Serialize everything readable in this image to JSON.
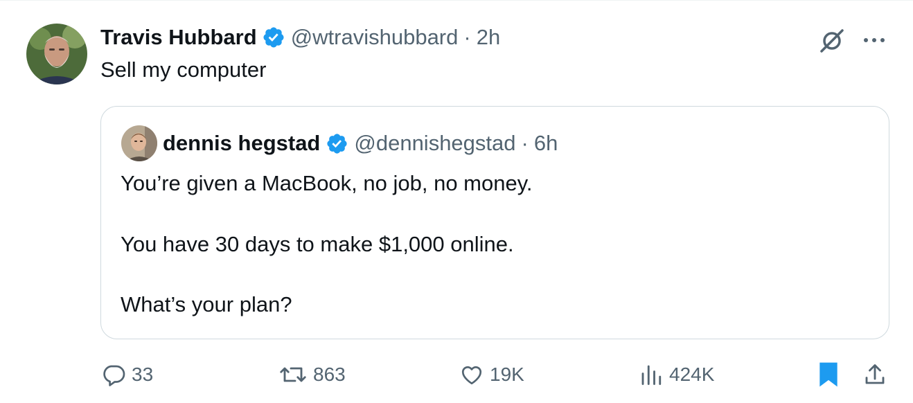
{
  "author": {
    "display_name": "Travis Hubbard",
    "handle": "@wtravishubbard",
    "separator": "·",
    "time": "2h",
    "verified": true
  },
  "tweet_text": "Sell my computer",
  "quoted": {
    "display_name": "dennis hegstad",
    "handle": "@dennishegstad",
    "separator": "·",
    "time": "6h",
    "verified": true,
    "lines": [
      "You’re given a MacBook, no job, no money.",
      "You have 30 days to make $1,000 online.",
      "What’s your plan?"
    ]
  },
  "actions": {
    "replies": "33",
    "reposts": "863",
    "likes": "19K",
    "views": "424K"
  },
  "icons": {
    "verified": "verified-badge-icon",
    "grok": "grok-icon",
    "more": "more-icon",
    "reply": "reply-icon",
    "repost": "repost-icon",
    "like": "heart-icon",
    "views": "views-icon",
    "bookmark": "bookmark-icon",
    "share": "share-icon"
  },
  "colors": {
    "text": "#0f1419",
    "secondary": "#536471",
    "verified": "#1d9bf0",
    "border": "#cfd9de"
  }
}
